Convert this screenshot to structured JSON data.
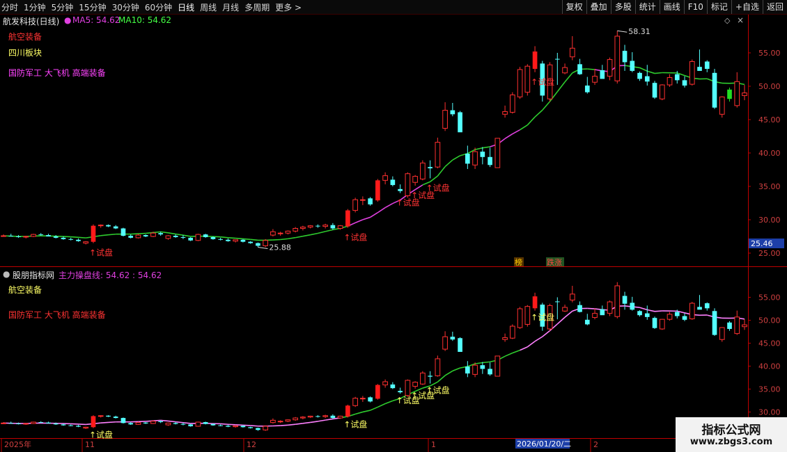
{
  "toolbar": {
    "periods": [
      "分时",
      "1分钟",
      "5分钟",
      "15分钟",
      "30分钟",
      "60分钟",
      "日线",
      "周线",
      "月线",
      "多周期",
      "更多 >"
    ],
    "active_period": "日线",
    "actions": [
      "复权",
      "叠加",
      "多股",
      "统计",
      "画线",
      "F10",
      "标记",
      "+自选",
      "返回"
    ]
  },
  "main_pane": {
    "title": "航发科技(日线)",
    "ma5_label": "MA5: 54.62",
    "ma10_label": "MA10: 54.62",
    "tags": [
      {
        "text": "航空装备",
        "color": "#ff3333"
      },
      {
        "text": "四川板块",
        "color": "#ffff66"
      },
      {
        "text": "国防军工 大飞机 高端装备",
        "color": "#ff44ff"
      }
    ],
    "high_label": "58.31",
    "low_label": "25.88",
    "price_box": "25.46",
    "bottom_tags": [
      {
        "text": "榜",
        "color": "#ffcc00"
      },
      {
        "text": "跌涨",
        "color": "#ff4444"
      }
    ],
    "signal_text": "↑试盘",
    "y_ticks": [
      "55.00",
      "50.00",
      "45.00",
      "40.00",
      "35.00",
      "30.00",
      "25.00"
    ]
  },
  "sub_pane": {
    "title": "股朋指标网",
    "line_label": "主力操盘线: 54.62 : 54.62",
    "tags": [
      {
        "text": "航空装备",
        "color": "#ffff66"
      },
      {
        "text": "国防军工 大飞机 高端装备",
        "color": "#ff3333"
      }
    ],
    "signal_text": "↑试盘",
    "y_ticks": [
      "55.00",
      "50.00",
      "45.00",
      "40.00",
      "35.00",
      "30.00"
    ]
  },
  "x_axis": {
    "labels": [
      "2025年",
      "11",
      "12",
      "1",
      "2"
    ],
    "highlight": "2026/01/20/二"
  },
  "watermark": {
    "line1": "指标公式网",
    "line2": "www.zbgs3.com"
  },
  "colors": {
    "up": "#ff3030",
    "down": "#54ffff",
    "ma5": "#ffffff",
    "ma10": "#44ff44",
    "midline": "#2ecc2e",
    "magenta": "#e040e0",
    "pink": "#ff80ff",
    "axis": "#c00000"
  },
  "chart_data": {
    "type": "candlestick",
    "candles": [
      [
        27.6,
        27.8,
        27.5,
        27.6
      ],
      [
        27.6,
        27.9,
        27.5,
        27.5
      ],
      [
        27.5,
        27.7,
        27.3,
        27.4
      ],
      [
        27.4,
        27.6,
        27.2,
        27.5
      ],
      [
        27.5,
        27.9,
        27.4,
        27.8
      ],
      [
        27.8,
        28.0,
        27.6,
        27.7
      ],
      [
        27.7,
        27.9,
        27.5,
        27.5
      ],
      [
        27.5,
        27.7,
        27.2,
        27.3
      ],
      [
        27.3,
        27.5,
        27.0,
        27.1
      ],
      [
        27.1,
        27.3,
        26.9,
        27.0
      ],
      [
        27.0,
        27.2,
        26.7,
        26.8
      ],
      [
        26.5,
        26.8,
        26.3,
        26.7
      ],
      [
        26.7,
        29.3,
        26.5,
        29.1
      ],
      [
        29.1,
        29.3,
        28.8,
        29.2
      ],
      [
        29.2,
        29.3,
        28.9,
        29.0
      ],
      [
        29.0,
        29.2,
        28.6,
        28.7
      ],
      [
        28.7,
        28.8,
        27.5,
        27.6
      ],
      [
        27.6,
        27.8,
        27.2,
        27.3
      ],
      [
        27.3,
        27.9,
        27.2,
        27.7
      ],
      [
        27.7,
        27.8,
        27.4,
        27.5
      ],
      [
        27.5,
        28.2,
        27.4,
        28.0
      ],
      [
        28.0,
        28.2,
        27.6,
        27.8
      ],
      [
        27.2,
        27.7,
        27.0,
        27.6
      ],
      [
        27.6,
        27.8,
        27.3,
        27.4
      ],
      [
        27.4,
        27.7,
        27.1,
        27.3
      ],
      [
        27.3,
        27.4,
        26.8,
        26.9
      ],
      [
        26.9,
        27.9,
        26.8,
        27.8
      ],
      [
        27.8,
        27.9,
        27.3,
        27.4
      ],
      [
        27.4,
        27.5,
        27.0,
        27.1
      ],
      [
        27.1,
        27.3,
        26.9,
        27.0
      ],
      [
        27.0,
        27.2,
        26.7,
        26.8
      ],
      [
        26.8,
        27.0,
        26.6,
        27.0
      ],
      [
        27.0,
        27.1,
        26.6,
        26.7
      ],
      [
        26.7,
        26.8,
        26.4,
        26.5
      ],
      [
        26.5,
        26.6,
        25.9,
        26.1
      ],
      [
        26.1,
        27.1,
        25.9,
        26.9
      ],
      [
        27.7,
        28.6,
        27.5,
        28.2
      ],
      [
        27.9,
        28.2,
        27.6,
        28.0
      ],
      [
        28.0,
        28.4,
        27.8,
        28.3
      ],
      [
        28.3,
        28.9,
        28.1,
        28.7
      ],
      [
        28.7,
        29.1,
        28.4,
        28.9
      ],
      [
        28.9,
        29.2,
        28.7,
        29.1
      ],
      [
        29.1,
        29.3,
        28.8,
        29.0
      ],
      [
        29.0,
        29.4,
        28.7,
        29.2
      ],
      [
        29.2,
        29.5,
        28.5,
        28.7
      ],
      [
        28.7,
        29.2,
        28.5,
        29.1
      ],
      [
        29.0,
        31.6,
        28.8,
        31.4
      ],
      [
        31.4,
        33.3,
        31.1,
        33.0
      ],
      [
        33.0,
        33.5,
        32.2,
        33.0
      ],
      [
        33.2,
        33.4,
        32.1,
        32.3
      ],
      [
        32.9,
        36.1,
        32.7,
        35.9
      ],
      [
        35.9,
        37.1,
        35.3,
        36.6
      ],
      [
        36.0,
        36.5,
        35.0,
        35.2
      ],
      [
        34.6,
        35.3,
        34.0,
        34.3
      ],
      [
        33.6,
        37.1,
        33.3,
        36.9
      ],
      [
        35.6,
        36.7,
        35.1,
        36.5
      ],
      [
        36.1,
        38.9,
        35.9,
        38.5
      ],
      [
        37.9,
        38.9,
        36.2,
        37.7
      ],
      [
        37.9,
        42.3,
        37.7,
        41.6
      ],
      [
        43.7,
        47.6,
        43.3,
        46.4
      ],
      [
        46.4,
        47.5,
        45.5,
        45.8
      ],
      [
        46.1,
        46.3,
        43.5,
        43.1
      ],
      [
        39.9,
        41.1,
        37.6,
        38.4
      ],
      [
        38.2,
        40.8,
        37.6,
        40.2
      ],
      [
        40.2,
        40.9,
        38.3,
        39.4
      ],
      [
        39.4,
        40.8,
        37.9,
        38.2
      ],
      [
        37.8,
        42.0,
        37.8,
        42.2
      ],
      [
        45.8,
        47.1,
        45.3,
        46.2
      ],
      [
        46.1,
        49.1,
        45.9,
        48.7
      ],
      [
        48.4,
        52.9,
        48.1,
        52.5
      ],
      [
        49.1,
        53.3,
        48.6,
        53.0
      ],
      [
        52.6,
        56.0,
        52.1,
        55.2
      ],
      [
        53.4,
        53.8,
        47.7,
        48.6
      ],
      [
        48.1,
        53.6,
        47.7,
        53.2
      ],
      [
        54.1,
        55.0,
        50.2,
        54.0
      ],
      [
        52.0,
        53.4,
        51.8,
        52.8
      ],
      [
        54.4,
        57.5,
        53.9,
        55.7
      ],
      [
        53.3,
        54.1,
        51.7,
        51.8
      ],
      [
        50.1,
        51.4,
        48.9,
        49.1
      ],
      [
        50.6,
        52.6,
        50.2,
        51.5
      ],
      [
        52.4,
        53.2,
        51.2,
        51.1
      ],
      [
        51.5,
        54.3,
        50.9,
        54.0
      ],
      [
        50.8,
        58.3,
        50.4,
        57.5
      ],
      [
        55.3,
        56.2,
        52.3,
        53.6
      ],
      [
        53.8,
        55.1,
        52.1,
        52.3
      ],
      [
        52.0,
        52.2,
        50.8,
        51.1
      ],
      [
        51.5,
        53.2,
        50.1,
        50.7
      ],
      [
        50.5,
        50.8,
        48.1,
        48.3
      ],
      [
        48.1,
        50.3,
        47.9,
        50.2
      ],
      [
        50.2,
        51.8,
        49.9,
        51.3
      ],
      [
        51.8,
        52.3,
        50.4,
        50.9
      ],
      [
        50.9,
        51.5,
        49.8,
        50.1
      ],
      [
        50.3,
        54.0,
        50.1,
        53.7
      ],
      [
        52.9,
        55.5,
        52.7,
        52.3
      ],
      [
        53.7,
        53.9,
        52.1,
        52.6
      ],
      [
        52.0,
        52.6,
        46.6,
        46.8
      ],
      [
        45.8,
        48.5,
        45.3,
        48.4
      ],
      [
        49.5,
        49.8,
        47.7,
        48.1
      ],
      [
        47.1,
        52.1,
        46.8,
        50.7
      ],
      [
        48.6,
        50.2,
        47.9,
        49.0
      ]
    ],
    "y_range": [
      24.5,
      58.9
    ],
    "y_tick_values": [
      25,
      30,
      35,
      40,
      45,
      50,
      55
    ],
    "x_labels": [
      "2025年",
      "11",
      "12",
      "1",
      "2"
    ]
  }
}
